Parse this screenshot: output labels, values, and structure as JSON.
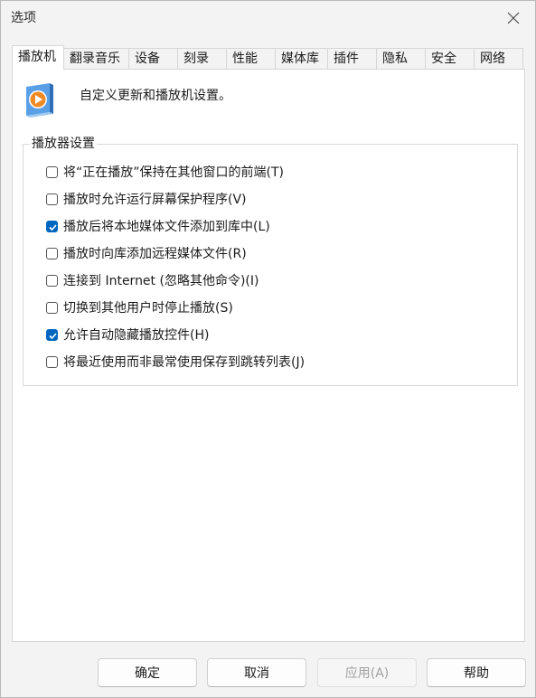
{
  "window": {
    "title": "选项"
  },
  "tabs": [
    {
      "label": "播放机",
      "active": true
    },
    {
      "label": "翻录音乐",
      "active": false
    },
    {
      "label": "设备",
      "active": false
    },
    {
      "label": "刻录",
      "active": false
    },
    {
      "label": "性能",
      "active": false
    },
    {
      "label": "媒体库",
      "active": false
    },
    {
      "label": "插件",
      "active": false
    },
    {
      "label": "隐私",
      "active": false
    },
    {
      "label": "安全",
      "active": false
    },
    {
      "label": "网络",
      "active": false
    }
  ],
  "panel": {
    "intro": "自定义更新和播放机设置。",
    "icon": "windows-media-player-icon",
    "group_label": "播放器设置",
    "options": [
      {
        "label": "将“正在播放”保持在其他窗口的前端(T)",
        "checked": false
      },
      {
        "label": "播放时允许运行屏幕保护程序(V)",
        "checked": false
      },
      {
        "label": "播放后将本地媒体文件添加到库中(L)",
        "checked": true
      },
      {
        "label": "播放时向库添加远程媒体文件(R)",
        "checked": false
      },
      {
        "label": "连接到 Internet (忽略其他命令)(I)",
        "checked": false
      },
      {
        "label": "切换到其他用户时停止播放(S)",
        "checked": false
      },
      {
        "label": "允许自动隐藏播放控件(H)",
        "checked": true
      },
      {
        "label": "将最近使用而非最常使用保存到跳转列表(J)",
        "checked": false
      }
    ]
  },
  "buttons": {
    "ok": "确定",
    "cancel": "取消",
    "apply": "应用(A)",
    "apply_enabled": false,
    "help": "帮助"
  },
  "colors": {
    "accent": "#0067c0",
    "icon_orange": "#f08a24",
    "icon_blue": "#4a90d9"
  }
}
